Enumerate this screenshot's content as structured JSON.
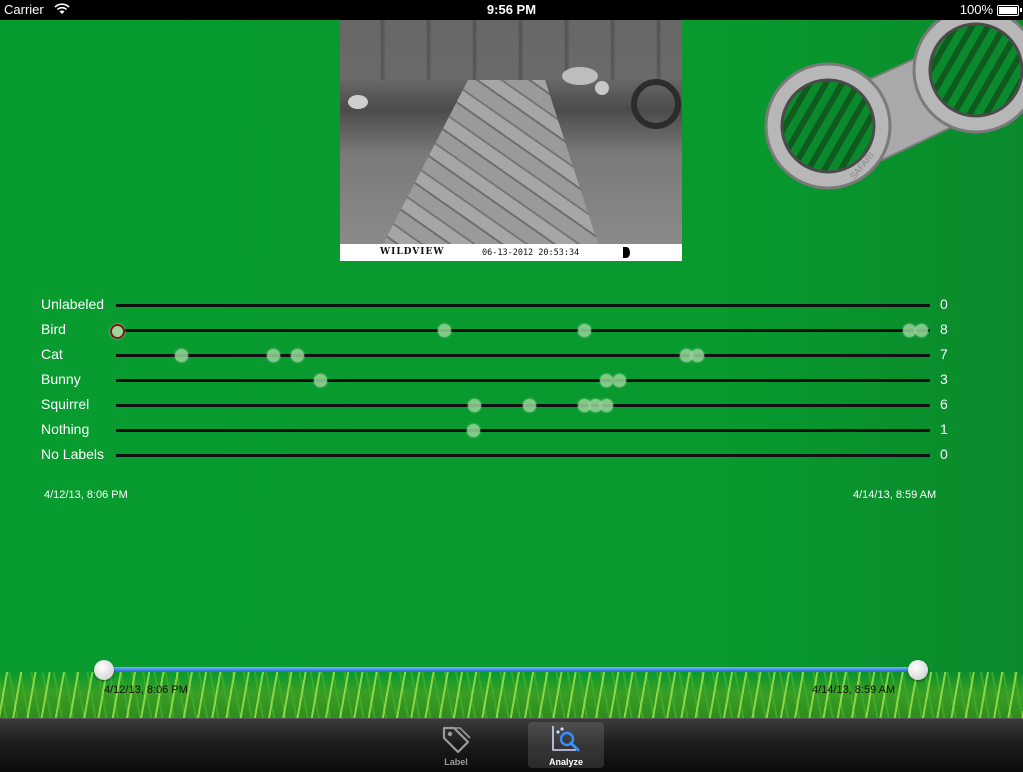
{
  "status_bar": {
    "carrier": "Carrier",
    "time": "9:56 PM",
    "battery": "100%"
  },
  "photo": {
    "brand": "WILDVIEW",
    "timestamp": "06-13-2012  20:53:34"
  },
  "logo": {
    "text": "SAFARI"
  },
  "chart_data": {
    "type": "scatter",
    "x_range": [
      "4/12/13, 8:06 PM",
      "4/14/13, 8:59 AM"
    ],
    "series": [
      {
        "name": "Unlabeled",
        "count": "0",
        "positions": []
      },
      {
        "name": "Bird",
        "count": "8",
        "positions": [
          0.0,
          0.403,
          0.575,
          0.975,
          0.99
        ]
      },
      {
        "name": "Cat",
        "count": "7",
        "positions": [
          0.081,
          0.194,
          0.223,
          0.701,
          0.714
        ]
      },
      {
        "name": "Bunny",
        "count": "3",
        "positions": [
          0.251,
          0.603,
          0.618
        ]
      },
      {
        "name": "Squirrel",
        "count": "6",
        "positions": [
          0.441,
          0.508,
          0.575,
          0.589,
          0.603
        ]
      },
      {
        "name": "Nothing",
        "count": "1",
        "positions": [
          0.439
        ]
      },
      {
        "name": "No Labels",
        "count": "0",
        "positions": []
      }
    ],
    "selected": {
      "series": 1,
      "index": 0
    }
  },
  "axis": {
    "start": "4/12/13, 8:06 PM",
    "end": "4/14/13, 8:59 AM"
  },
  "range": {
    "start": "4/12/13, 8:06 PM",
    "end": "4/14/13, 8:59 AM"
  },
  "tabs": [
    {
      "label": "Label",
      "icon": "tag-icon",
      "active": false
    },
    {
      "label": "Analyze",
      "icon": "analyze-icon",
      "active": true
    }
  ]
}
